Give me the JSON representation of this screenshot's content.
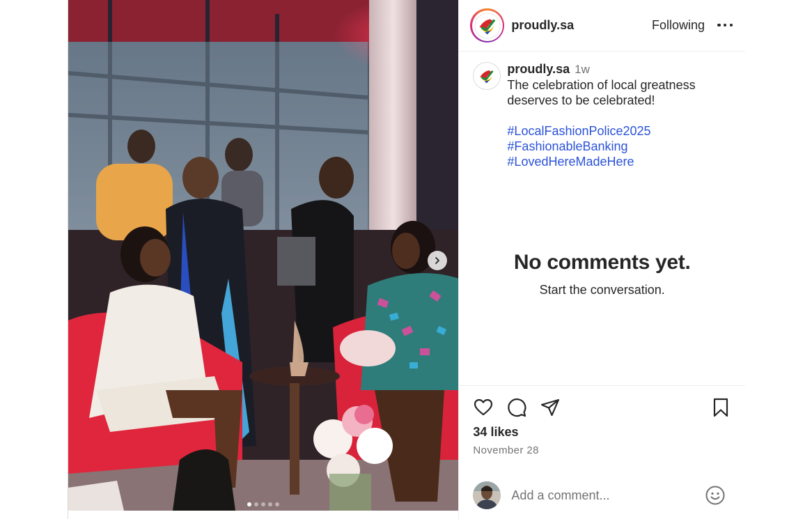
{
  "post": {
    "username": "proudly.sa",
    "follow_status": "Following",
    "more_icon": "more-horizontal-icon"
  },
  "caption": {
    "username": "proudly.sa",
    "time_ago": "1w",
    "text": "The celebration of local greatness deserves to be celebrated!",
    "hashtags": [
      "#LocalFashionPolice2025",
      "#FashionableBanking",
      "#LovedHereMadeHere"
    ],
    "hashtag_color": "#2b53d9"
  },
  "comments": {
    "empty_title": "No comments yet.",
    "empty_subtitle": "Start the conversation."
  },
  "actions": {
    "icons": [
      "heart-icon",
      "comment-icon",
      "share-icon",
      "bookmark-icon"
    ],
    "likes": "34 likes",
    "date": "November 28"
  },
  "comment_box": {
    "placeholder": "Add a comment...",
    "emoji_icon": "emoji-icon"
  },
  "carousel": {
    "slide_count": 5,
    "active_index": 0,
    "next_icon": "chevron-right-icon"
  }
}
